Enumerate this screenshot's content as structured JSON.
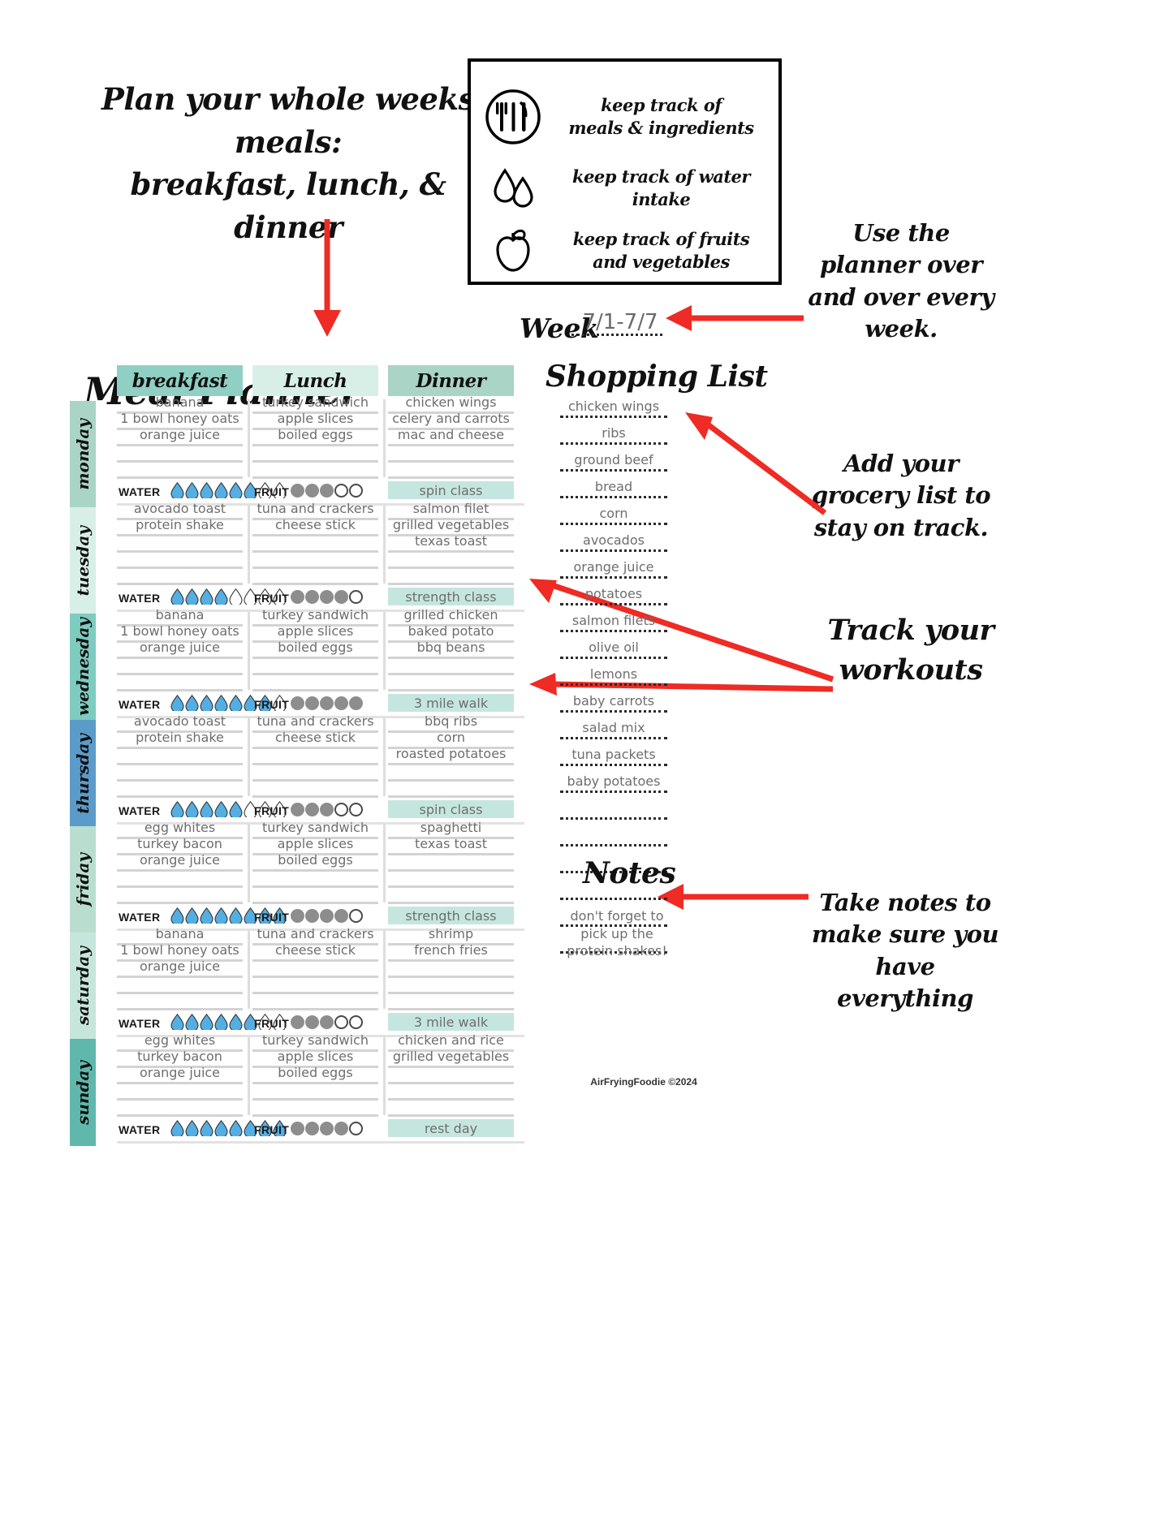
{
  "intro": {
    "text": "Plan your whole weeks meals:\nbreakfast, lunch, & dinner"
  },
  "feature_box": {
    "rows": [
      {
        "icon": "plate-fork-knife-icon",
        "text": "keep track of\nmeals & ingredients"
      },
      {
        "icon": "water-drops-icon",
        "text": "keep track of water intake"
      },
      {
        "icon": "apple-icon",
        "text": "keep track of fruits\nand vegetables"
      }
    ]
  },
  "annotations": [
    {
      "id": "annot-0",
      "text": "Use the planner over and over every week."
    },
    {
      "id": "annot-1",
      "text": "Add your grocery list to stay on track."
    },
    {
      "id": "annot-2",
      "text": "Track your workouts"
    },
    {
      "id": "annot-3",
      "text": "Take notes to make sure you have everything"
    }
  ],
  "planner": {
    "title": "Meal Planner",
    "week_label": "Week",
    "week_value": "7/1-7/7",
    "columns": [
      "breakfast",
      "Lunch",
      "Dinner"
    ],
    "water_label": "WATER",
    "fruit_label": "FRUIT",
    "water_total": 8,
    "fruit_total": 5,
    "days": [
      {
        "name": "monday",
        "tab_color": "#a9d4c6",
        "breakfast": [
          "banana",
          "1 bowl honey oats",
          "orange juice",
          "",
          ""
        ],
        "lunch": [
          "turkey sandwich",
          "apple slices",
          "boiled eggs",
          "",
          ""
        ],
        "dinner": [
          "chicken wings",
          "celery and carrots",
          "mac and cheese",
          "",
          ""
        ],
        "water_filled": 6,
        "fruit_filled": 3,
        "workout": "spin class"
      },
      {
        "name": "tuesday",
        "tab_color": "#d8efe8",
        "breakfast": [
          "avocado toast",
          "protein shake",
          "",
          "",
          ""
        ],
        "lunch": [
          "tuna and crackers",
          "cheese stick",
          "",
          "",
          ""
        ],
        "dinner": [
          "salmon filet",
          "grilled vegetables",
          "texas toast",
          "",
          ""
        ],
        "water_filled": 4,
        "fruit_filled": 4,
        "workout": "strength class"
      },
      {
        "name": "wednesday",
        "tab_color": "#7ecbc0",
        "breakfast": [
          "banana",
          "1 bowl honey oats",
          "orange juice",
          "",
          ""
        ],
        "lunch": [
          "turkey sandwich",
          "apple slices",
          "boiled eggs",
          "",
          ""
        ],
        "dinner": [
          "grilled chicken",
          "baked potato",
          "bbq beans",
          "",
          ""
        ],
        "water_filled": 7,
        "fruit_filled": 5,
        "workout": "3 mile walk"
      },
      {
        "name": "thursday",
        "tab_color": "#5b9bc9",
        "breakfast": [
          "avocado toast",
          "protein shake",
          "",
          "",
          ""
        ],
        "lunch": [
          "tuna and crackers",
          "cheese stick",
          "",
          "",
          ""
        ],
        "dinner": [
          "bbq ribs",
          "corn",
          "roasted potatoes",
          "",
          ""
        ],
        "water_filled": 5,
        "fruit_filled": 3,
        "workout": "spin class"
      },
      {
        "name": "friday",
        "tab_color": "#b9ded0",
        "breakfast": [
          "egg whites",
          "turkey bacon",
          "orange juice",
          "",
          ""
        ],
        "lunch": [
          "turkey sandwich",
          "apple slices",
          "boiled eggs",
          "",
          ""
        ],
        "dinner": [
          "spaghetti",
          "texas toast",
          "",
          "",
          ""
        ],
        "water_filled": 8,
        "fruit_filled": 4,
        "workout": "strength class"
      },
      {
        "name": "saturday",
        "tab_color": "#c6e6dc",
        "breakfast": [
          "banana",
          "1 bowl honey oats",
          "orange juice",
          "",
          ""
        ],
        "lunch": [
          "tuna and crackers",
          "cheese stick",
          "",
          "",
          ""
        ],
        "dinner": [
          "shrimp",
          "french fries",
          "",
          "",
          ""
        ],
        "water_filled": 6,
        "fruit_filled": 3,
        "workout": "3 mile walk"
      },
      {
        "name": "sunday",
        "tab_color": "#5fb8ab",
        "breakfast": [
          "egg whites",
          "turkey bacon",
          "orange juice",
          "",
          ""
        ],
        "lunch": [
          "turkey sandwich",
          "apple slices",
          "boiled eggs",
          "",
          ""
        ],
        "dinner": [
          "chicken and rice",
          "grilled vegetables",
          "",
          "",
          ""
        ],
        "water_filled": 8,
        "fruit_filled": 4,
        "workout": "rest day"
      }
    ]
  },
  "shopping": {
    "title": "Shopping List",
    "items": [
      "chicken wings",
      "ribs",
      "ground beef",
      "bread",
      "corn",
      "avocados",
      "orange juice",
      "potatoes",
      "salmon filets",
      "olive oil",
      "lemons",
      "baby carrots",
      "salad mix",
      "tuna packets",
      "baby potatoes",
      "",
      "",
      "",
      "",
      "",
      ""
    ]
  },
  "notes": {
    "title": "Notes",
    "body": "don't forget to pick up the protein shakes!"
  },
  "footer": {
    "credit": "AirFryingFoodie ©2024"
  },
  "colors": {
    "accent_dark": "#8fcfc4",
    "accent_light": "#d8efe8",
    "accent_mid": "#a9d4c6",
    "workout_bg": "#c5e6de",
    "water_fill": "#55aee2",
    "fruit_fill": "#8d8d8d",
    "arrow_red": "#ee2b24",
    "text_gray": "#6e6e6e"
  }
}
